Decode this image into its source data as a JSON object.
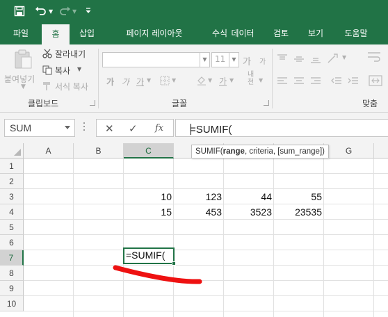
{
  "theme": {
    "accent": "#217346",
    "annotation_color": "#ee1111"
  },
  "quick_access": {
    "save_icon": "save-icon",
    "undo_icon": "undo-icon",
    "redo_icon": "redo-icon",
    "customize_icon": "chevron-down-icon"
  },
  "ribbon_tabs": [
    "파일",
    "홈",
    "삽입",
    "페이지 레이아웃",
    "수식",
    "데이터",
    "검토",
    "보기",
    "도움말"
  ],
  "ribbon_active_tab": "홈",
  "clipboard": {
    "paste_label": "붙여넣기",
    "cut_label": "잘라내기",
    "copy_label": "복사",
    "format_painter_label": "서식 복사",
    "group_label": "클립보드"
  },
  "font": {
    "font_size": "11",
    "grow_label": "가",
    "shrink_label": "가",
    "bold_label": "가",
    "italic_label": "가",
    "underline_label": "가",
    "font_color_label": "가",
    "phonetic_label": "내천",
    "group_label": "글꼴"
  },
  "alignment": {
    "group_label": "맞춤"
  },
  "formula_bar": {
    "name_box": "SUM",
    "cancel_symbol": "✕",
    "enter_symbol": "✓",
    "fx_symbol": "fx",
    "formula": "=SUMIF("
  },
  "tooltip": {
    "func": "SUMIF(",
    "arg_bold": "range",
    "rest": ", criteria, [sum_range])"
  },
  "sheet": {
    "columns": [
      "A",
      "B",
      "C",
      "",
      "",
      "",
      "G"
    ],
    "rows": [
      "1",
      "2",
      "3",
      "4",
      "5",
      "6",
      "7",
      "8",
      "9",
      "10"
    ],
    "row3": [
      "10",
      "123",
      "44",
      "55"
    ],
    "row4": [
      "15",
      "453",
      "3523",
      "23535"
    ],
    "active_cell_text": "=SUMIF("
  }
}
